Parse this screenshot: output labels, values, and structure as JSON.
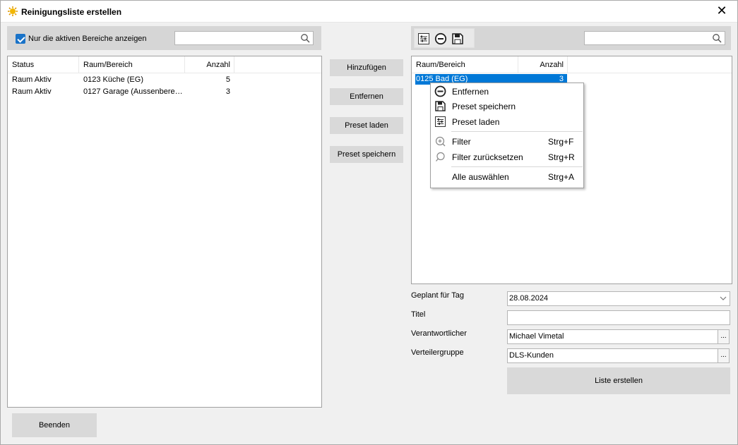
{
  "window": {
    "title": "Reinigungsliste erstellen",
    "close_label": "✕"
  },
  "left": {
    "checkbox_label": "Nur die aktiven Bereiche anzeigen",
    "search_placeholder": "",
    "columns": [
      "Status",
      "Raum/Bereich",
      "Anzahl"
    ],
    "rows": [
      {
        "status": "Raum Aktiv",
        "raum": "0123 Küche (EG)",
        "anzahl": "5"
      },
      {
        "status": "Raum Aktiv",
        "raum": "0127 Garage (Aussenbere…",
        "anzahl": "3"
      }
    ]
  },
  "middle": {
    "add_label": "Hinzufügen",
    "remove_label": "Entfernen",
    "load_label": "Preset laden",
    "save_label": "Preset speichern"
  },
  "right": {
    "search_placeholder": "",
    "toolbar_icons": [
      "preset-load-icon",
      "remove-icon",
      "save-icon"
    ],
    "columns": [
      "Raum/Bereich",
      "Anzahl"
    ],
    "rows": [
      {
        "raum": "0125 Bad (EG)",
        "anzahl": "3",
        "selected": true
      }
    ]
  },
  "context_menu": {
    "items": [
      {
        "label": "Entfernen",
        "icon": "remove-icon",
        "shortcut": ""
      },
      {
        "label": "Preset speichern",
        "icon": "save-icon",
        "shortcut": ""
      },
      {
        "label": "Preset laden",
        "icon": "preset-load-icon",
        "shortcut": ""
      },
      {
        "label": "Filter",
        "icon": "filter-icon",
        "shortcut": "Strg+F"
      },
      {
        "label": "Filter zurücksetzen",
        "icon": "filter-reset-icon",
        "shortcut": "Strg+R"
      },
      {
        "label": "Alle auswählen",
        "icon": "",
        "shortcut": "Strg+A"
      }
    ]
  },
  "form": {
    "date_label": "Geplant für Tag",
    "date_value": "28.08.2024",
    "title_label": "Titel",
    "title_value": "",
    "responsible_label": "Verantwortlicher",
    "responsible_value": "Michael Vimetal",
    "group_label": "Verteilergruppe",
    "group_value": "DLS-Kunden",
    "ellipsis": "...",
    "create_label": "Liste erstellen"
  },
  "footer": {
    "exit_label": "Beenden"
  },
  "colors": {
    "accent": "#0078d7",
    "checkbox": "#1a73c8",
    "button": "#d9d9d9"
  }
}
